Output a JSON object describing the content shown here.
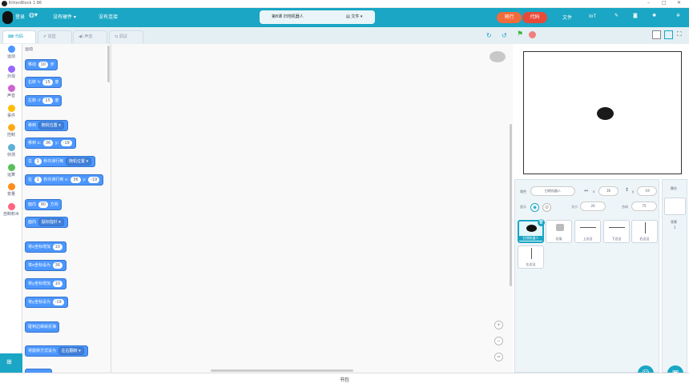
{
  "window": {
    "title": "KittenBlock 1.86"
  },
  "menu": {
    "logo_label": "登录",
    "lang_icon": "globe-icon",
    "no_hardware": "没有硬件",
    "no_connect": "没有连接",
    "project_name": "第8课 扫地机器人",
    "file_menu": "文件",
    "upload": "预行",
    "code": "代码",
    "file": "文件",
    "iot": "IoT"
  },
  "tabs": [
    {
      "label": "代码",
      "icon": "code-icon"
    },
    {
      "label": "造型",
      "icon": "brush-icon"
    },
    {
      "label": "声音",
      "icon": "speaker-icon"
    },
    {
      "label": "调试",
      "icon": "debug-icon"
    }
  ],
  "categories": [
    {
      "label": "运动",
      "color": "#4c97ff"
    },
    {
      "label": "外观",
      "color": "#9966ff"
    },
    {
      "label": "声音",
      "color": "#cf63cf"
    },
    {
      "label": "事件",
      "color": "#ffbf00"
    },
    {
      "label": "控制",
      "color": "#ffab19"
    },
    {
      "label": "侦测",
      "color": "#5cb1d6"
    },
    {
      "label": "运算",
      "color": "#59c059"
    },
    {
      "label": "变量",
      "color": "#ff8c1a"
    },
    {
      "label": "自制积木",
      "color": "#ff6680"
    }
  ],
  "palette": {
    "section_title": "运动",
    "blocks": {
      "move": {
        "a": "移动",
        "v": "10",
        "b": "步"
      },
      "turn_right": {
        "a": "右转",
        "v": "15",
        "b": "度"
      },
      "turn_left": {
        "a": "左转",
        "v": "15",
        "b": "度"
      },
      "goto": {
        "a": "移到",
        "d": "随机位置"
      },
      "goto_xy": {
        "a": "移到 x:",
        "x": "36",
        "y_lbl": "y:",
        "y": "-19"
      },
      "glide": {
        "a": "在",
        "v": "1",
        "b": "秒内滑行到",
        "d": "随机位置"
      },
      "glide_xy": {
        "a": "在",
        "v": "1",
        "b": "秒内滑行到 x:",
        "x": "36",
        "y_lbl": "y:",
        "y": "-19"
      },
      "point_dir": {
        "a": "面向",
        "v": "90",
        "b": "方向"
      },
      "point_to": {
        "a": "面向",
        "d": "鼠标指针"
      },
      "change_x": {
        "a": "将x坐标增加",
        "v": "10"
      },
      "set_x": {
        "a": "将x坐标设为",
        "v": "36"
      },
      "change_y": {
        "a": "将y坐标增加",
        "v": "10"
      },
      "set_y": {
        "a": "将y坐标设为",
        "v": "-19"
      },
      "bounce": {
        "a": "碰到边缘就反弹"
      },
      "rotation": {
        "a": "将旋转方式设为",
        "d": "左右翻转"
      }
    }
  },
  "bottom": {
    "label": "书包"
  },
  "sprite": {
    "name_label": "角色",
    "name": "扫地机器人",
    "x_label": "x",
    "x": "36",
    "y_label": "y",
    "y": "-19",
    "show_label": "显示",
    "size_label": "大小",
    "size": "20",
    "dir_label": "方向",
    "dir": "75"
  },
  "sprites": [
    {
      "name": "扫地机器人"
    },
    {
      "name": "垃圾"
    },
    {
      "name": "上边沿"
    },
    {
      "name": "下边沿"
    },
    {
      "name": "右边沿"
    },
    {
      "name": "左边沿"
    }
  ],
  "stage_panel": {
    "label": "舞台",
    "backdrops_label": "背景",
    "backdrops_count": "1"
  }
}
